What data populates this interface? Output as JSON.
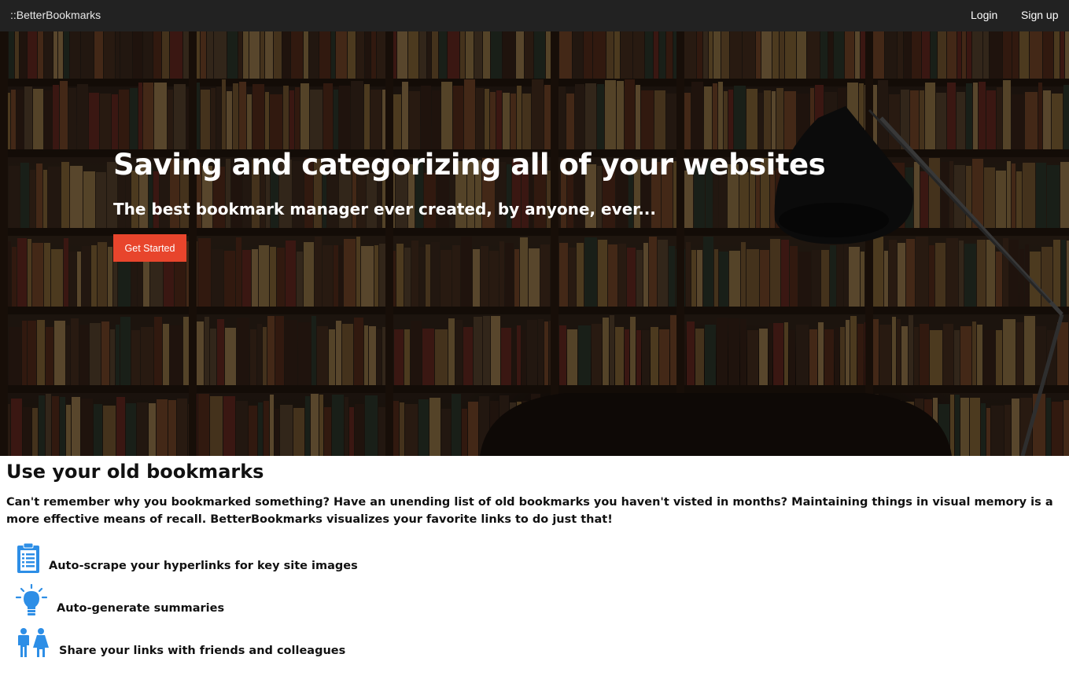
{
  "navbar": {
    "brand": "::BetterBookmarks",
    "login": "Login",
    "signup": "Sign up"
  },
  "hero": {
    "title": "Saving and categorizing all of your websites",
    "subtitle": "The best bookmark manager ever created, by anyone, ever...",
    "cta_label": "Get Started",
    "cta_color": "#e8452c",
    "background_image": "bookshelf-library-with-desk-lamp"
  },
  "intro": {
    "title": "Use your old bookmarks",
    "text": "Can't remember why you bookmarked something? Have an unending list of old bookmarks you haven't visted in months? Maintaining things in visual memory is a more effective means of recall. BetterBookmarks visualizes your favorite links to do just that!"
  },
  "features": [
    {
      "icon": "clipboard-icon",
      "label": "Auto-scrape your hyperlinks for key site images"
    },
    {
      "icon": "lightbulb-icon",
      "label": "Auto-generate summaries"
    },
    {
      "icon": "people-icon",
      "label": "Share your links with friends and colleagues"
    }
  ],
  "colors": {
    "navbar_bg": "#222222",
    "icon_blue": "#2d8ee6",
    "button_red": "#e8452c"
  }
}
